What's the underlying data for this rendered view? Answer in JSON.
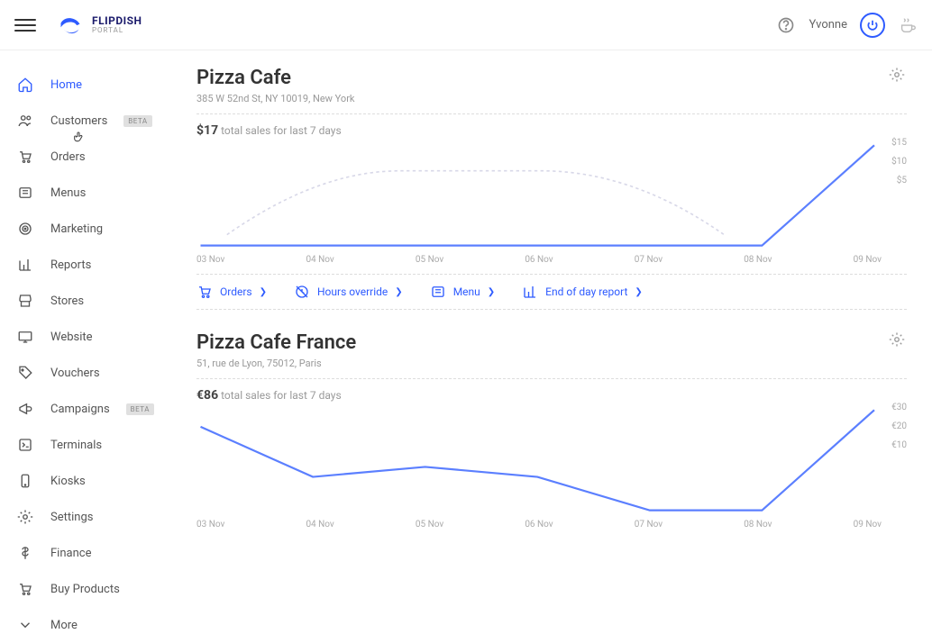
{
  "brand": {
    "name": "FLIPDISH",
    "sub": "PORTAL"
  },
  "user": {
    "name": "Yvonne"
  },
  "sidebar": {
    "items": [
      {
        "label": "Home",
        "icon": "home",
        "active": true
      },
      {
        "label": "Customers",
        "icon": "users",
        "badge": "BETA"
      },
      {
        "label": "Orders",
        "icon": "cart"
      },
      {
        "label": "Menus",
        "icon": "menu"
      },
      {
        "label": "Marketing",
        "icon": "marketing"
      },
      {
        "label": "Reports",
        "icon": "chart"
      },
      {
        "label": "Stores",
        "icon": "store"
      },
      {
        "label": "Website",
        "icon": "desktop"
      },
      {
        "label": "Vouchers",
        "icon": "tag"
      },
      {
        "label": "Campaigns",
        "icon": "megaphone",
        "badge": "BETA"
      },
      {
        "label": "Terminals",
        "icon": "terminal"
      },
      {
        "label": "Kiosks",
        "icon": "tablet"
      },
      {
        "label": "Settings",
        "icon": "gear"
      },
      {
        "label": "Finance",
        "icon": "dollar"
      },
      {
        "label": "Buy Products",
        "icon": "cart2"
      },
      {
        "label": "More",
        "icon": "more"
      }
    ]
  },
  "stores": [
    {
      "title": "Pizza Cafe",
      "address": "385 W 52nd St, NY 10019, New York",
      "currency": "$",
      "sales_amount": "17",
      "sales_text": "total sales for last 7 days",
      "quicklinks": [
        {
          "label": "Orders",
          "icon": "cart"
        },
        {
          "label": "Hours override",
          "icon": "clock-off"
        },
        {
          "label": "Menu",
          "icon": "menu"
        },
        {
          "label": "End of day report",
          "icon": "chart"
        }
      ]
    },
    {
      "title": "Pizza Cafe France",
      "address": "51, rue de Lyon, 75012, Paris",
      "currency": "€",
      "sales_amount": "86",
      "sales_text": "total sales for last 7 days"
    }
  ],
  "chart_data": [
    {
      "type": "line",
      "title": "total sales for last 7 days",
      "categories": [
        "03 Nov",
        "04 Nov",
        "05 Nov",
        "06 Nov",
        "07 Nov",
        "08 Nov",
        "09 Nov"
      ],
      "series": [
        {
          "name": "sales",
          "values": [
            0,
            0,
            0,
            0,
            0,
            0,
            17
          ]
        }
      ],
      "ylim": [
        0,
        15
      ],
      "yticks": [
        15,
        10,
        5
      ],
      "xlabel": "",
      "ylabel": ""
    },
    {
      "type": "line",
      "title": "total sales for last 7 days",
      "categories": [
        "03 Nov",
        "04 Nov",
        "05 Nov",
        "06 Nov",
        "07 Nov",
        "08 Nov",
        "09 Nov"
      ],
      "series": [
        {
          "name": "sales",
          "values": [
            25,
            10,
            13,
            10,
            0,
            0,
            34
          ]
        }
      ],
      "ylim": [
        0,
        30
      ],
      "yticks": [
        30,
        20,
        10
      ],
      "xlabel": "",
      "ylabel": ""
    }
  ]
}
